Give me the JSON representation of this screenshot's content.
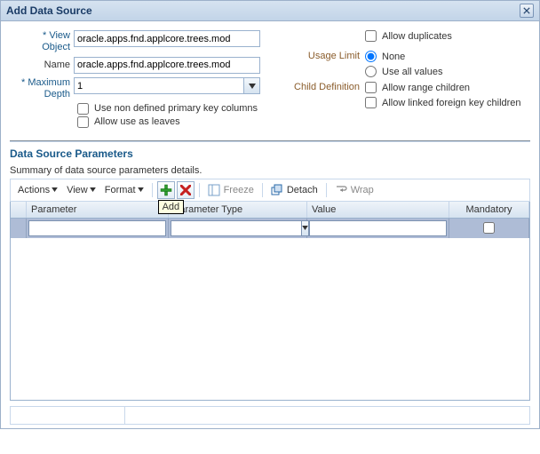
{
  "dialog": {
    "title": "Add Data Source",
    "close_aria": "Close"
  },
  "form": {
    "view_object": {
      "label_line1": "* View",
      "label_line2": "Object",
      "value": "oracle.apps.fnd.applcore.trees.mod"
    },
    "name": {
      "label": "Name",
      "value": "oracle.apps.fnd.applcore.trees.mod"
    },
    "max_depth": {
      "label_line1": "* Maximum",
      "label_line2": "Depth",
      "value": "1"
    },
    "use_non_defined_pk": "Use non defined primary key columns",
    "allow_use_as_leaves": "Allow use as leaves",
    "allow_duplicates": "Allow duplicates",
    "usage_limit": {
      "label": "Usage Limit",
      "opt_none": "None",
      "opt_use_all": "Use all values"
    },
    "child_definition": {
      "label": "Child Definition",
      "allow_range": "Allow range children",
      "allow_linked_fk": "Allow linked foreign key children"
    }
  },
  "section": {
    "title": "Data Source Parameters",
    "summary": "Summary of data source parameters details."
  },
  "toolbar": {
    "actions": "Actions",
    "view": "View",
    "format": "Format",
    "add_tooltip": "Add",
    "freeze": "Freeze",
    "detach": "Detach",
    "wrap": "Wrap"
  },
  "columns": {
    "parameter": "Parameter",
    "parameter_type": "Parameter Type",
    "value": "Value",
    "mandatory": "Mandatory"
  },
  "row1": {
    "parameter": "",
    "parameter_type": "",
    "value": "",
    "mandatory": false
  }
}
